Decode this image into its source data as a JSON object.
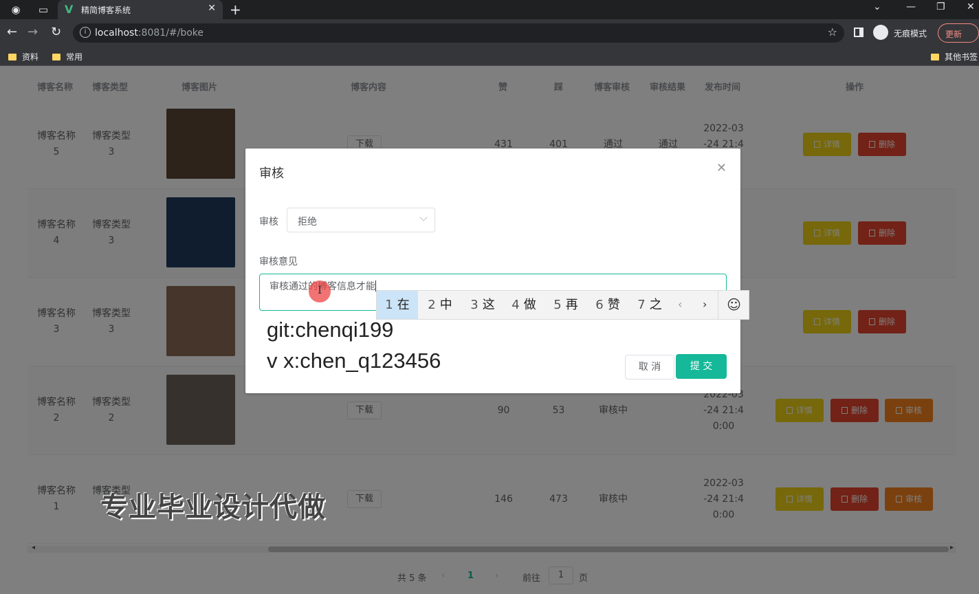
{
  "browser": {
    "tab_title": "精简博客系统",
    "url_host": "localhost",
    "url_rest": ":8081/#/boke",
    "incognito_label": "无痕模式",
    "update_label": "更新",
    "bookmarks": [
      "资料",
      "常用"
    ],
    "other_bookmarks": "其他书签"
  },
  "table": {
    "headers": [
      "博客名称",
      "博客类型",
      "博客图片",
      "博客内容",
      "赞",
      "踩",
      "博客审核",
      "审核结果",
      "发布时间",
      "操作"
    ],
    "download_label": "下载",
    "detail_label": "详情",
    "delete_label": "删除",
    "review_label": "审核",
    "rows": [
      {
        "name_a": "博客名称",
        "name_b": "5",
        "type_a": "博客类型",
        "type_b": "3",
        "likes": "431",
        "dislikes": "401",
        "review": "通过",
        "result": "通过",
        "time_a": "2022-03",
        "time_b": "-24 21:4",
        "time_c": "",
        "thumb": "#5a4636"
      },
      {
        "name_a": "博客名称",
        "name_b": "4",
        "type_a": "博客类型",
        "type_b": "3",
        "likes": "",
        "dislikes": "",
        "review": "",
        "result": "",
        "time_a": "",
        "time_b": "",
        "time_c": "",
        "thumb": "#1f3a5c"
      },
      {
        "name_a": "博客名称",
        "name_b": "3",
        "type_a": "博客类型",
        "type_b": "3",
        "likes": "",
        "dislikes": "",
        "review": "",
        "result": "",
        "time_a": "",
        "time_b": "",
        "time_c": "",
        "thumb": "#8a6b55"
      },
      {
        "name_a": "博客名称",
        "name_b": "2",
        "type_a": "博客类型",
        "type_b": "2",
        "likes": "90",
        "dislikes": "53",
        "review": "审核中",
        "result": "",
        "time_a": "2022-03",
        "time_b": "-24 21:4",
        "time_c": "0:00",
        "thumb": "#6c6258"
      },
      {
        "name_a": "博客名称",
        "name_b": "1",
        "type_a": "博客类型",
        "type_b": "",
        "likes": "146",
        "dislikes": "473",
        "review": "审核中",
        "result": "",
        "time_a": "2022-03",
        "time_b": "-24 21:4",
        "time_c": "0:00",
        "thumb": ""
      }
    ]
  },
  "pagination": {
    "total": "共 5 条",
    "prev": "‹",
    "current": "1",
    "next": "›",
    "goto_label": "前往",
    "goto_value": "1",
    "page_label": "页"
  },
  "dialog": {
    "title": "审核",
    "review_label": "审核",
    "review_value": "拒绝",
    "opinion_label": "审核意见",
    "opinion_value": "审核通过的博客信息才能",
    "cancel_label": "取 消",
    "submit_label": "提 交"
  },
  "ime": {
    "candidates": [
      {
        "num": "1",
        "char": "在"
      },
      {
        "num": "2",
        "char": "中"
      },
      {
        "num": "3",
        "char": "这"
      },
      {
        "num": "4",
        "char": "做"
      },
      {
        "num": "5",
        "char": "再"
      },
      {
        "num": "6",
        "char": "赞"
      },
      {
        "num": "7",
        "char": "之"
      }
    ],
    "selected_index": 0
  },
  "overlay": {
    "line1": "git:chenqi199",
    "line2": "v x:chen_q123456",
    "watermark": "专业毕业设计代做"
  },
  "colors": {
    "accent": "#15b898",
    "detail": "#ecd117",
    "delete": "#e5442c",
    "review": "#f5821f"
  }
}
